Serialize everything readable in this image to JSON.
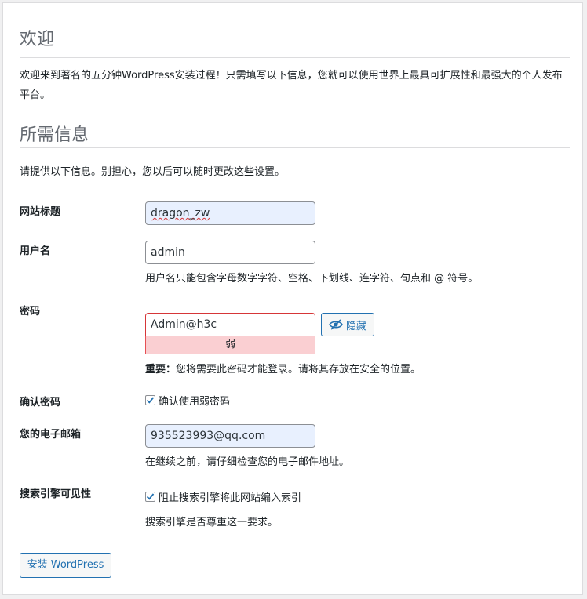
{
  "welcome": {
    "heading": "欢迎",
    "intro": "欢迎来到著名的五分钟WordPress安装过程！只需填写以下信息，您就可以使用世界上最具可扩展性和最强大的个人发布平台。"
  },
  "info": {
    "heading": "所需信息",
    "intro": "请提供以下信息。别担心，您以后可以随时更改这些设置。"
  },
  "form": {
    "site_title": {
      "label": "网站标题",
      "value": "dragon_zw"
    },
    "username": {
      "label": "用户名",
      "value": "admin",
      "hint": "用户名只能包含字母数字字符、空格、下划线、连字符、句点和 @ 符号。"
    },
    "password": {
      "label": "密码",
      "value": "Admin@h3c",
      "strength": "弱",
      "hide_label": "隐藏",
      "hint_strong": "重要：",
      "hint": "您将需要此密码才能登录。请将其存放在安全的位置。"
    },
    "confirm_password": {
      "label": "确认密码",
      "checkbox_label": "确认使用弱密码",
      "checked": true
    },
    "email": {
      "label": "您的电子邮箱",
      "value": "935523993@qq.com",
      "hint": "在继续之前，请仔细检查您的电子邮件地址。"
    },
    "search_visibility": {
      "label": "搜索引擎可见性",
      "checkbox_label": "阻止搜索引擎将此网站编入索引",
      "checked": true,
      "hint": "搜索引擎是否尊重这一要求。"
    }
  },
  "install_button": "安装 WordPress",
  "colors": {
    "accent": "#2271b1",
    "error": "#d63638",
    "weak_bg": "#facfd2"
  },
  "icons": {
    "hide": "eye-slash-icon",
    "check": "checkmark-icon"
  }
}
